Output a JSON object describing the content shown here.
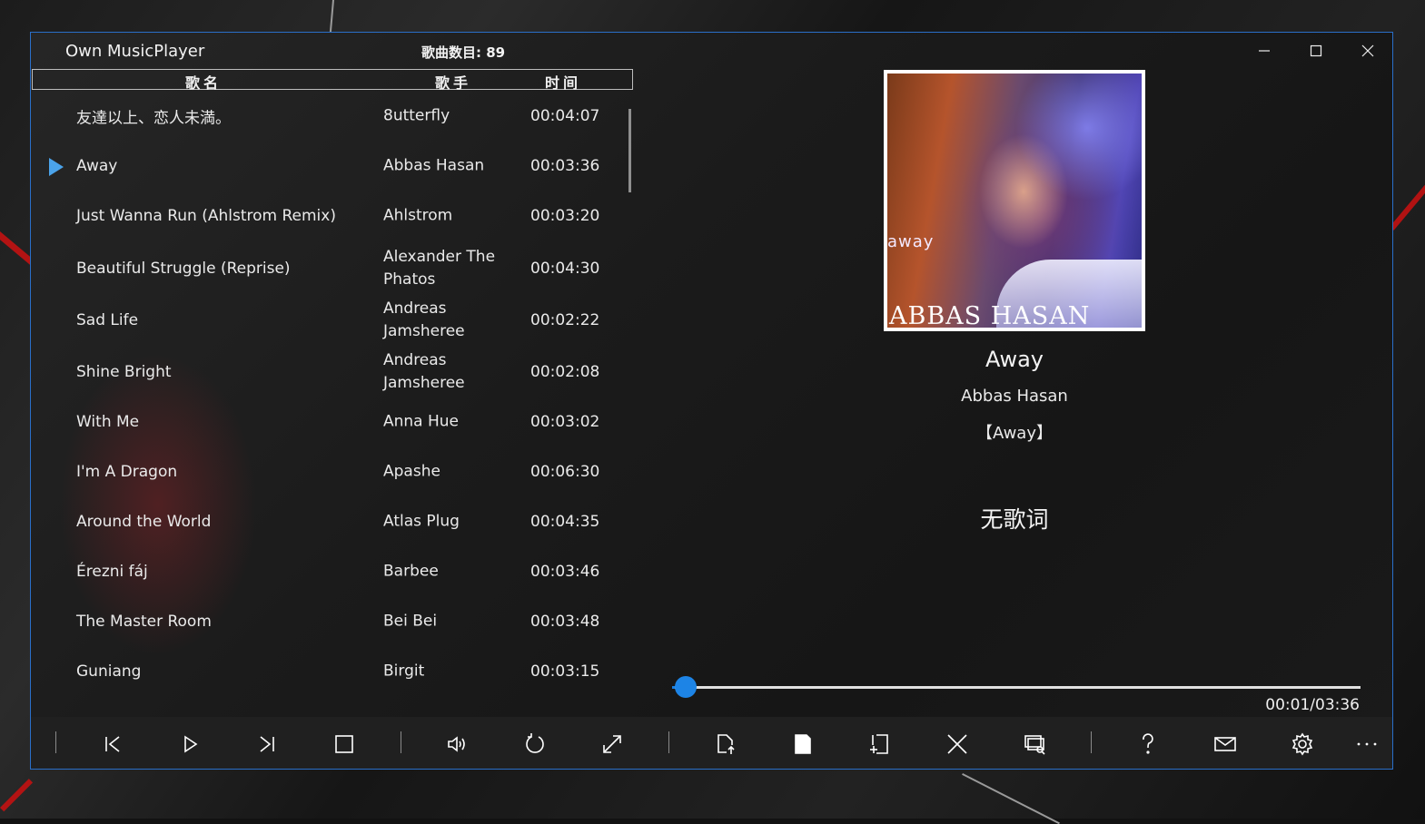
{
  "app": {
    "title": "Own MusicPlayer",
    "song_count_label": "歌曲数目: 89"
  },
  "window_controls": {
    "minimize": "—",
    "maximize": "☐",
    "close": "✕"
  },
  "list": {
    "headers": {
      "title": "歌名",
      "artist": "歌手",
      "time": "时间"
    },
    "rows": [
      {
        "title": "友達以上、恋人未満。",
        "artist": "8utterfly",
        "time": "00:04:07",
        "playing": false
      },
      {
        "title": "Away",
        "artist": "Abbas Hasan",
        "time": "00:03:36",
        "playing": true
      },
      {
        "title": "Just Wanna Run (Ahlstrom Remix)",
        "artist": "Ahlstrom",
        "time": "00:03:20",
        "playing": false
      },
      {
        "title": "Beautiful Struggle (Reprise)",
        "artist": "Alexander The Phatos",
        "time": "00:04:30",
        "playing": false
      },
      {
        "title": "Sad Life",
        "artist": "Andreas Jamsheree",
        "time": "00:02:22",
        "playing": false
      },
      {
        "title": "Shine Bright",
        "artist": "Andreas Jamsheree",
        "time": "00:02:08",
        "playing": false
      },
      {
        "title": "With Me",
        "artist": "Anna Hue",
        "time": "00:03:02",
        "playing": false
      },
      {
        "title": "I'm A Dragon",
        "artist": "Apashe",
        "time": "00:06:30",
        "playing": false
      },
      {
        "title": "Around the World",
        "artist": "Atlas Plug",
        "time": "00:04:35",
        "playing": false
      },
      {
        "title": "Érezni fáj",
        "artist": "Barbee",
        "time": "00:03:46",
        "playing": false
      },
      {
        "title": "The Master Room",
        "artist": "Bei Bei",
        "time": "00:03:48",
        "playing": false
      },
      {
        "title": "Guniang",
        "artist": "Birgit",
        "time": "00:03:15",
        "playing": false
      }
    ]
  },
  "now_playing": {
    "cover_text_small": "away",
    "cover_text_large": "ABBAS HASAN",
    "title": "Away",
    "artist": "Abbas Hasan",
    "album": "【Away】",
    "lyrics_placeholder": "无歌词",
    "elapsed": "00:01",
    "duration": "03:36",
    "time_display": "00:01/03:36",
    "progress_fraction": 0.0046
  },
  "toolbar": {
    "buttons": [
      {
        "name": "previous-icon"
      },
      {
        "name": "play-icon"
      },
      {
        "name": "next-icon"
      },
      {
        "name": "stop-icon"
      },
      {
        "name": "volume-icon"
      },
      {
        "name": "repeat-icon"
      },
      {
        "name": "fullscreen-icon"
      },
      {
        "name": "open-file-icon"
      },
      {
        "name": "page-icon"
      },
      {
        "name": "add-page-icon"
      },
      {
        "name": "close-x-icon"
      },
      {
        "name": "search-screen-icon"
      },
      {
        "name": "help-icon"
      },
      {
        "name": "mail-icon"
      },
      {
        "name": "settings-icon"
      },
      {
        "name": "more-icon"
      }
    ]
  },
  "colors": {
    "accent": "#1d84e6",
    "play_marker": "#4ba3ea",
    "window_border": "#2a6fc9"
  }
}
